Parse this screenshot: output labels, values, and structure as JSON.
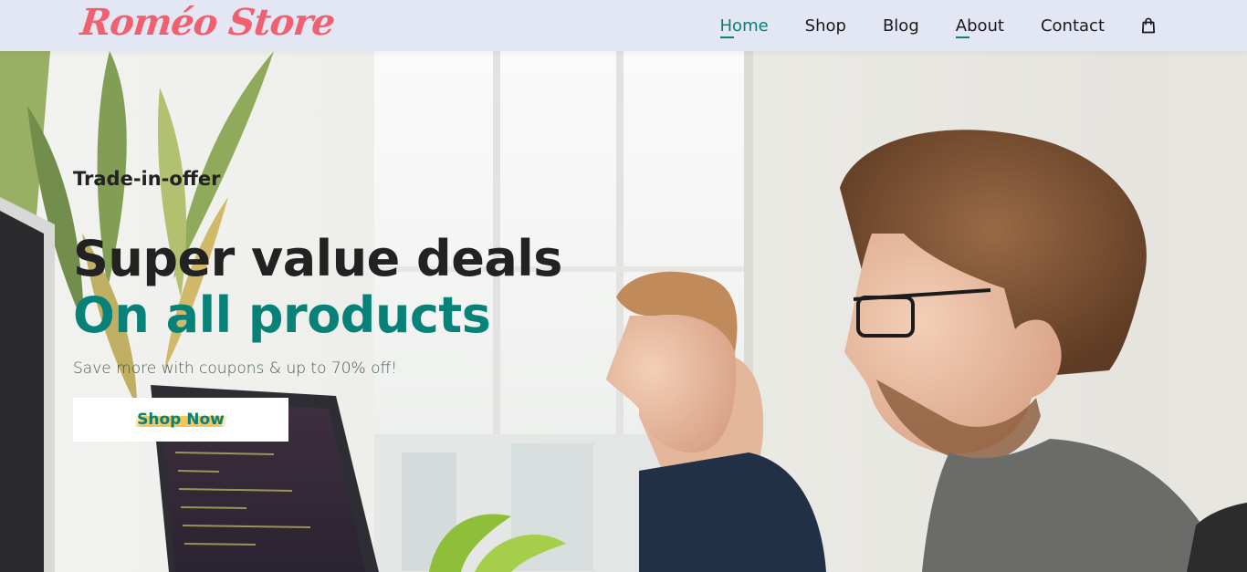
{
  "header": {
    "logo": "Roméo Store",
    "nav": [
      {
        "label": "Home",
        "active": true
      },
      {
        "label": "Shop",
        "active": false
      },
      {
        "label": "Blog",
        "active": false
      },
      {
        "label": "About",
        "active": false
      },
      {
        "label": "Contact",
        "active": false
      }
    ],
    "cart_icon": "shopping-bag-icon"
  },
  "hero": {
    "eyebrow": "Trade-in-offer",
    "headline": "Super value deals",
    "subheadline": "On all products",
    "promo": "Save more with coupons & up to 70% off!",
    "button_label": "Shop Now"
  },
  "colors": {
    "accent": "#088178",
    "logo": "#f0606e",
    "header_bg": "#e3e6f3",
    "button_highlight": "#f9c458",
    "text_dark": "#222222"
  }
}
